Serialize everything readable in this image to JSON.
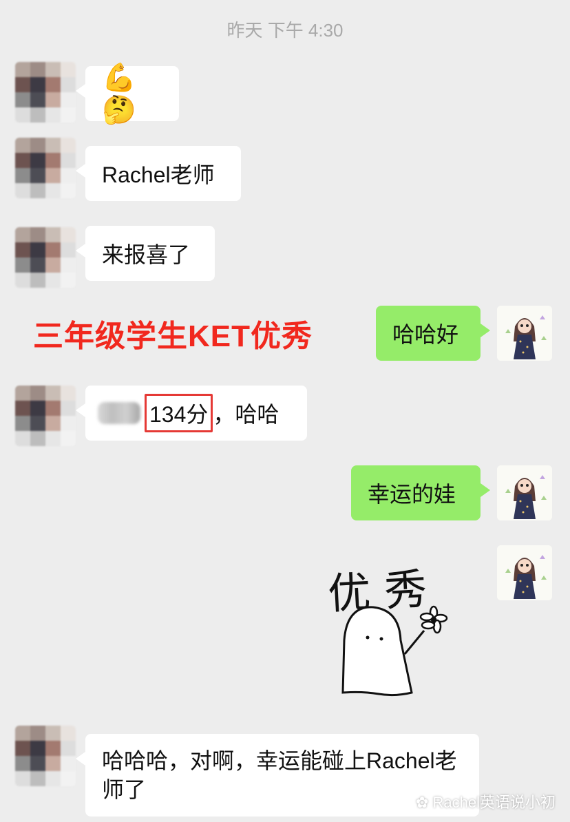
{
  "chat": {
    "timestamp": "昨天 下午 4:30",
    "messages": [
      {
        "side": "in",
        "text": "💪🤔"
      },
      {
        "side": "in",
        "text": "Rachel老师"
      },
      {
        "side": "in",
        "text": "来报喜了"
      },
      {
        "side": "out",
        "text": "哈哈好"
      },
      {
        "side": "in",
        "score": "134分",
        "after": "，哈哈"
      },
      {
        "side": "out",
        "text": "幸运的娃"
      },
      {
        "side": "out",
        "sticker_text": "优秀"
      },
      {
        "side": "in",
        "text": "哈哈哈，对啊，幸运能碰上Rachel老师了"
      }
    ]
  },
  "overlay": {
    "red_caption": "三年级学生KET优秀",
    "watermark": "Rachel英语说小初"
  },
  "colors": {
    "background": "#ededed",
    "outgoing_bubble": "#95ec69",
    "incoming_bubble": "#ffffff",
    "caption": "#f1281e"
  }
}
